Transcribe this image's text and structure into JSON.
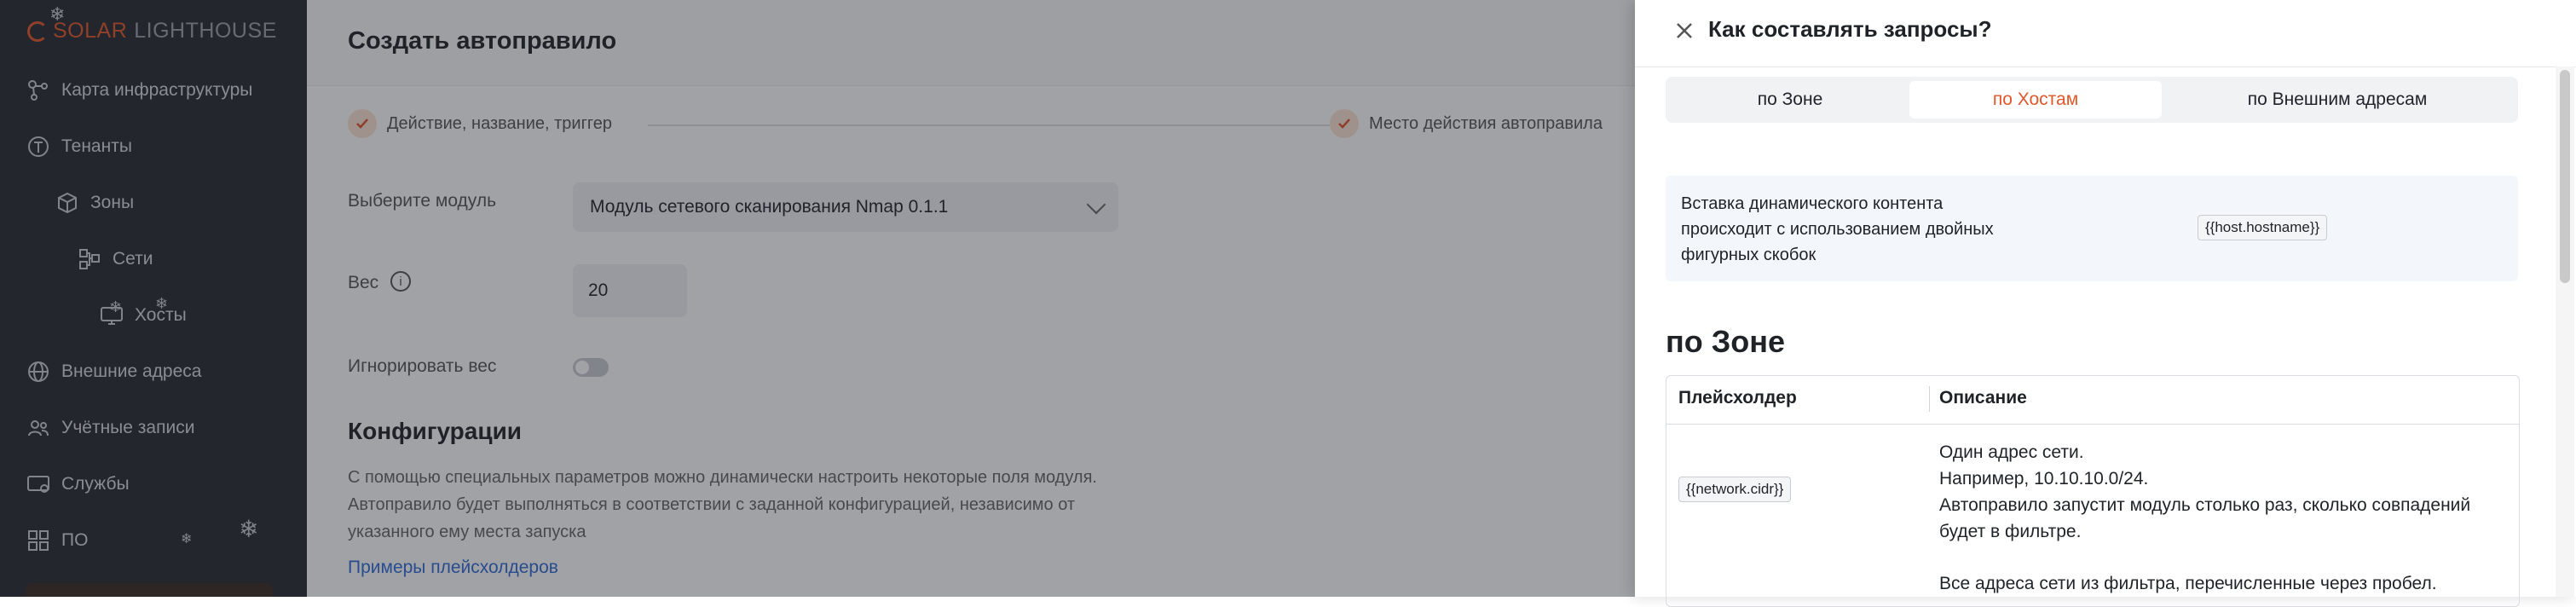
{
  "sidebar": {
    "logo_solar": "SOLAR",
    "logo_rest": "LIGHTHOUSE",
    "items": [
      {
        "label": "Карта инфраструктуры",
        "icon": "graph-icon"
      },
      {
        "label": "Тенанты",
        "icon": "tenant-icon"
      },
      {
        "label": "Зоны",
        "icon": "cube-icon"
      },
      {
        "label": "Сети",
        "icon": "network-icon"
      },
      {
        "label": "Хосты",
        "icon": "monitor-icon"
      },
      {
        "label": "Внешние адреса",
        "icon": "globe-icon"
      },
      {
        "label": "Учётные записи",
        "icon": "users-icon"
      },
      {
        "label": "Службы",
        "icon": "service-icon"
      },
      {
        "label": "ПО",
        "icon": "software-icon"
      }
    ]
  },
  "main": {
    "title": "Создать автоправило",
    "steps": [
      {
        "label": "Действие, название, триггер"
      },
      {
        "label": "Место действия автоправила"
      }
    ],
    "module_label": "Выберите модуль",
    "module_value": "Модуль сетевого сканирования Nmap 0.1.1",
    "weight_label": "Вес",
    "weight_value": "20",
    "ignore_weight_label": "Игнорировать вес",
    "config_title": "Конфигурации",
    "config_desc": "С помощью специальных параметров можно динамически настроить некоторые поля модуля. Автоправило будет выполняться в соответствии с заданной конфигурацией, независимо от указанного ему места запуска",
    "placeholders_link": "Примеры плейсхолдеров"
  },
  "drawer": {
    "title": "Как составлять запросы?",
    "tabs": [
      {
        "label": "по Зоне",
        "active": false
      },
      {
        "label": "по Хостам",
        "active": true
      },
      {
        "label": "по Внешним адресам",
        "active": false
      }
    ],
    "callout_text": "Вставка динамического контента происходит с использованием двойных фигурных скобок",
    "callout_chip": "{{host.hostname}}",
    "section_title": "по Зоне",
    "table": {
      "headers": [
        "Плейсхолдер",
        "Описание"
      ],
      "rows": [
        {
          "placeholder": "{{network.cidr}}",
          "desc_lines": [
            "Один адрес сети.",
            "Например, 10.10.10.0/24.",
            "Автоправило запустит модуль столько раз, сколько совпадений будет в фильтре."
          ]
        }
      ],
      "partial_row_text": "Все адреса сети из фильтра, перечисленные через пробел."
    }
  },
  "colors": {
    "accent": "#e2572a",
    "sidebar_bg": "#272b31",
    "link": "#2f6bd8"
  }
}
